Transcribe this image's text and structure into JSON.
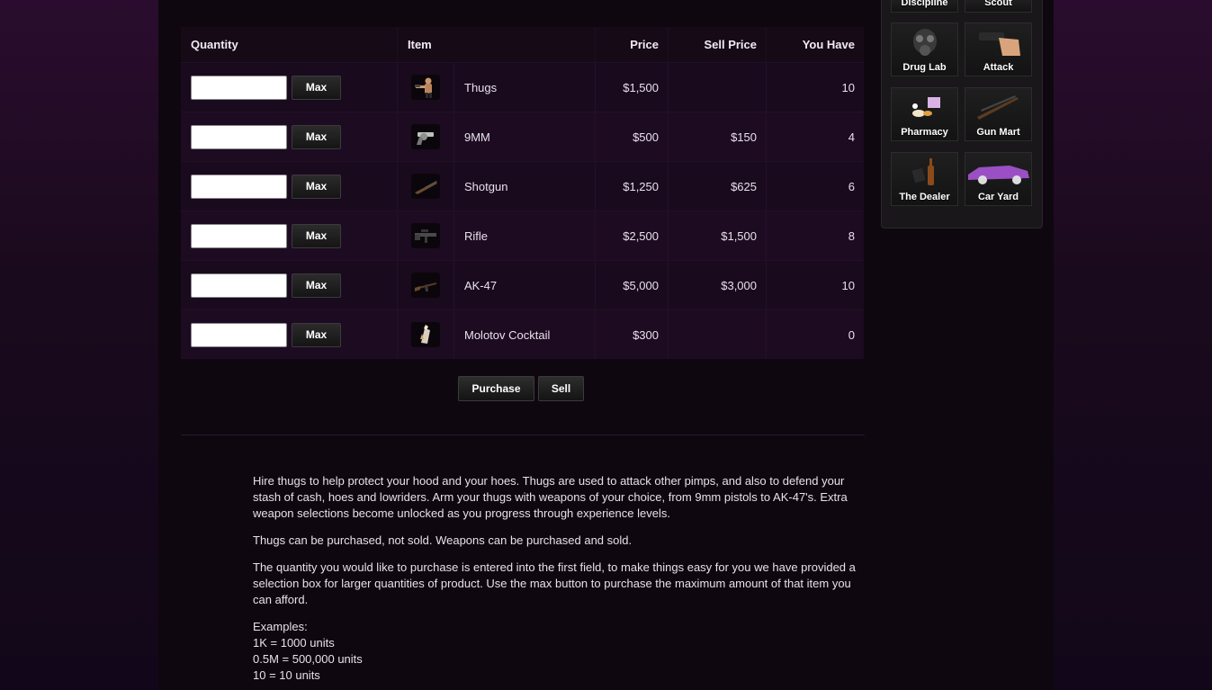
{
  "table": {
    "headers": {
      "quantity": "Quantity",
      "item": "Item",
      "price": "Price",
      "sell_price": "Sell Price",
      "you_have": "You Have"
    },
    "max_label": "Max",
    "rows": [
      {
        "name": "Thugs",
        "price": "$1,500",
        "sell": "",
        "have": "10",
        "icon": "thug-icon"
      },
      {
        "name": "9MM",
        "price": "$500",
        "sell": "$150",
        "have": "4",
        "icon": "revolver-icon"
      },
      {
        "name": "Shotgun",
        "price": "$1,250",
        "sell": "$625",
        "have": "6",
        "icon": "shotgun-icon"
      },
      {
        "name": "Rifle",
        "price": "$2,500",
        "sell": "$1,500",
        "have": "8",
        "icon": "rifle-icon"
      },
      {
        "name": "AK-47",
        "price": "$5,000",
        "sell": "$3,000",
        "have": "10",
        "icon": "ak47-icon"
      },
      {
        "name": "Molotov Cocktail",
        "price": "$300",
        "sell": "",
        "have": "0",
        "icon": "molotov-icon"
      }
    ]
  },
  "actions": {
    "purchase": "Purchase",
    "sell": "Sell"
  },
  "help": {
    "p1": "Hire thugs to help protect your hood and your hoes. Thugs are used to attack other pimps, and also to defend your stash of cash, hoes and lowriders. Arm your thugs with weapons of your choice, from 9mm pistols to AK-47's. Extra weapon selections become unlocked as you progress through experience levels.",
    "p2": "Thugs can be purchased, not sold. Weapons can be purchased and sold.",
    "p3": "The quantity you would like to purchase is entered into the first field, to make things easy for you we have provided a selection box for larger quantities of product. Use the max button to purchase the maximum amount of that item you can afford.",
    "examples_title": "Examples:",
    "examples": [
      "1K = 1000 units",
      "0.5M = 500,000 units",
      "10 = 10 units"
    ]
  },
  "side_nav": {
    "discipline": "Discipline",
    "scout": "Scout",
    "drug_lab": "Drug Lab",
    "attack": "Attack",
    "pharmacy": "Pharmacy",
    "gun_mart": "Gun Mart",
    "the_dealer": "The Dealer",
    "car_yard": "Car Yard"
  }
}
